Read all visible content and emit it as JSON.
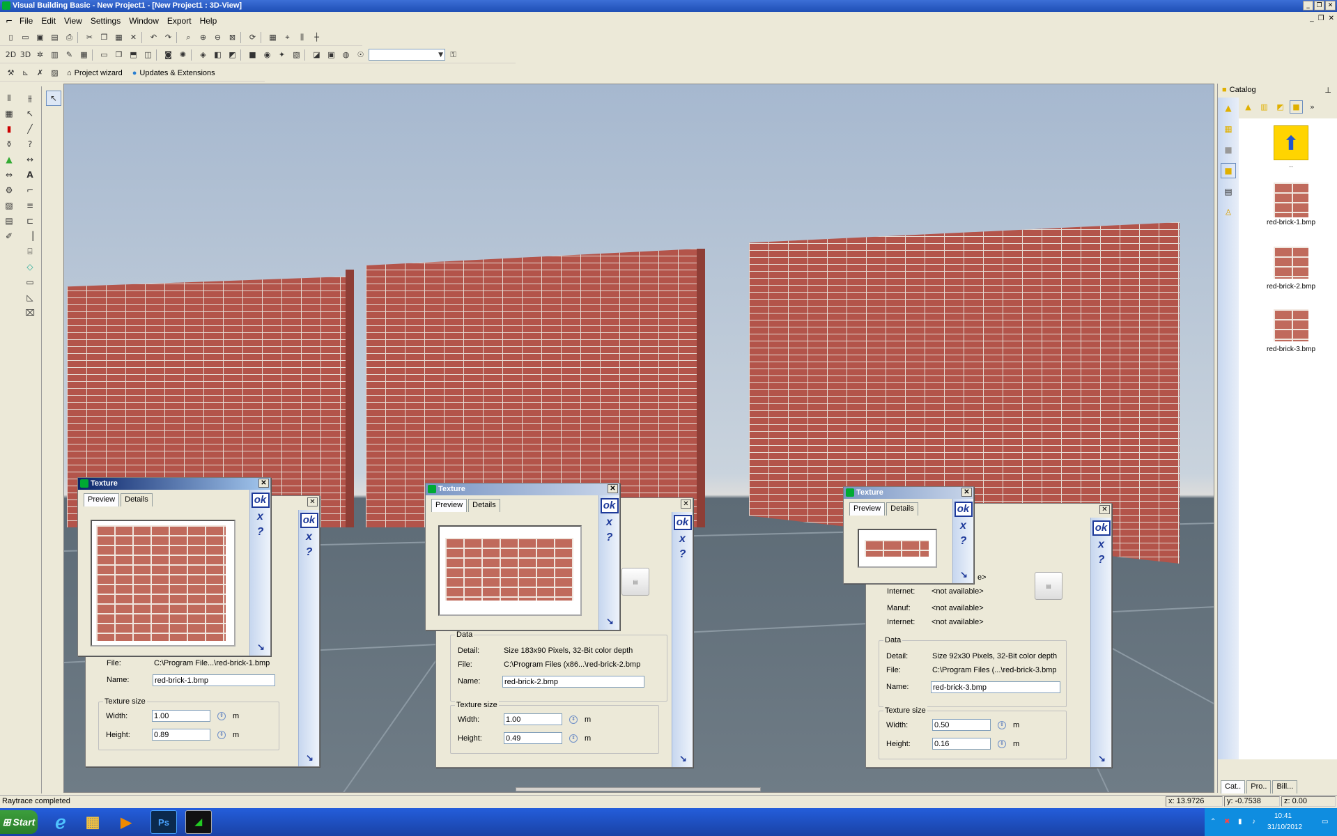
{
  "app": {
    "title": "Visual Building Basic - New Project1 - [New Project1 : 3D-View]",
    "window_buttons": [
      "_",
      "❐",
      "✕"
    ],
    "mdi_buttons": [
      "_",
      "❐",
      "✕"
    ]
  },
  "menu": [
    "File",
    "Edit",
    "View",
    "Settings",
    "Window",
    "Export",
    "Help"
  ],
  "toolbar3": {
    "project_wizard": "Project wizard",
    "updates": "Updates & Extensions"
  },
  "toolbar2": {
    "mode_2d": "2D",
    "mode_3d": "3D"
  },
  "catalog": {
    "title": "Catalog",
    "up_label": "..",
    "items": [
      {
        "label": "red-brick-1.bmp"
      },
      {
        "label": "red-brick-2.bmp"
      },
      {
        "label": "red-brick-3.bmp"
      }
    ],
    "bottom_tabs": [
      "Cat..",
      "Pro..",
      "Bill..."
    ]
  },
  "dialogs": [
    {
      "title": "Texture",
      "tab_preview": "Preview",
      "tab_details": "Details",
      "ok": "ok",
      "x": "x",
      "q": "?",
      "corner": "↘",
      "file_label": "File:",
      "file_value": "C:\\Program File...\\red-brick-1.bmp",
      "name_label": "Name:",
      "name_value": "red-brick-1.bmp",
      "size_group": "Texture size",
      "width_label": "Width:",
      "width_value": "1.00",
      "height_label": "Height:",
      "height_value": "0.89",
      "unit": "m"
    },
    {
      "title": "Texture",
      "tab_preview": "Preview",
      "tab_details": "Details",
      "ok": "ok",
      "x": "x",
      "q": "?",
      "corner": "↘",
      "data_group": "Data",
      "detail_label": "Detail:",
      "detail_value": "Size 183x90 Pixels, 32-Bit color depth",
      "file_label": "File:",
      "file_value": "C:\\Program Files (x86...\\red-brick-2.bmp",
      "name_label": "Name:",
      "name_value": "red-brick-2.bmp",
      "size_group": "Texture size",
      "width_label": "Width:",
      "width_value": "1.00",
      "height_label": "Height:",
      "height_value": "0.49",
      "unit": "m"
    },
    {
      "title": "Texture",
      "tab_preview": "Preview",
      "tab_details": "Details",
      "ok": "ok",
      "x": "x",
      "q": "?",
      "corner": "↘",
      "partial_e": "e>",
      "internet_label": "Internet:",
      "internet_value": "<not available>",
      "manuf_label": "Manuf:",
      "manuf_value": "<not available>",
      "internet2_label": "Internet:",
      "internet2_value": "<not available>",
      "data_group": "Data",
      "detail_label": "Detail:",
      "detail_value": "Size 92x30 Pixels, 32-Bit color depth",
      "file_label": "File:",
      "file_value": "C:\\Program Files (...\\red-brick-3.bmp",
      "name_label": "Name:",
      "name_value": "red-brick-3.bmp",
      "size_group": "Texture size",
      "width_label": "Width:",
      "width_value": "0.50",
      "height_label": "Height:",
      "height_value": "0.16",
      "unit": "m"
    }
  ],
  "status": {
    "message": "Raytrace completed",
    "x": "x: 13.9726",
    "y": "y: -0.7538",
    "z": "z: 0.00"
  },
  "taskbar": {
    "start": "Start",
    "clock_time": "10:41",
    "clock_date": "31/10/2012",
    "ps_label": "Ps"
  }
}
